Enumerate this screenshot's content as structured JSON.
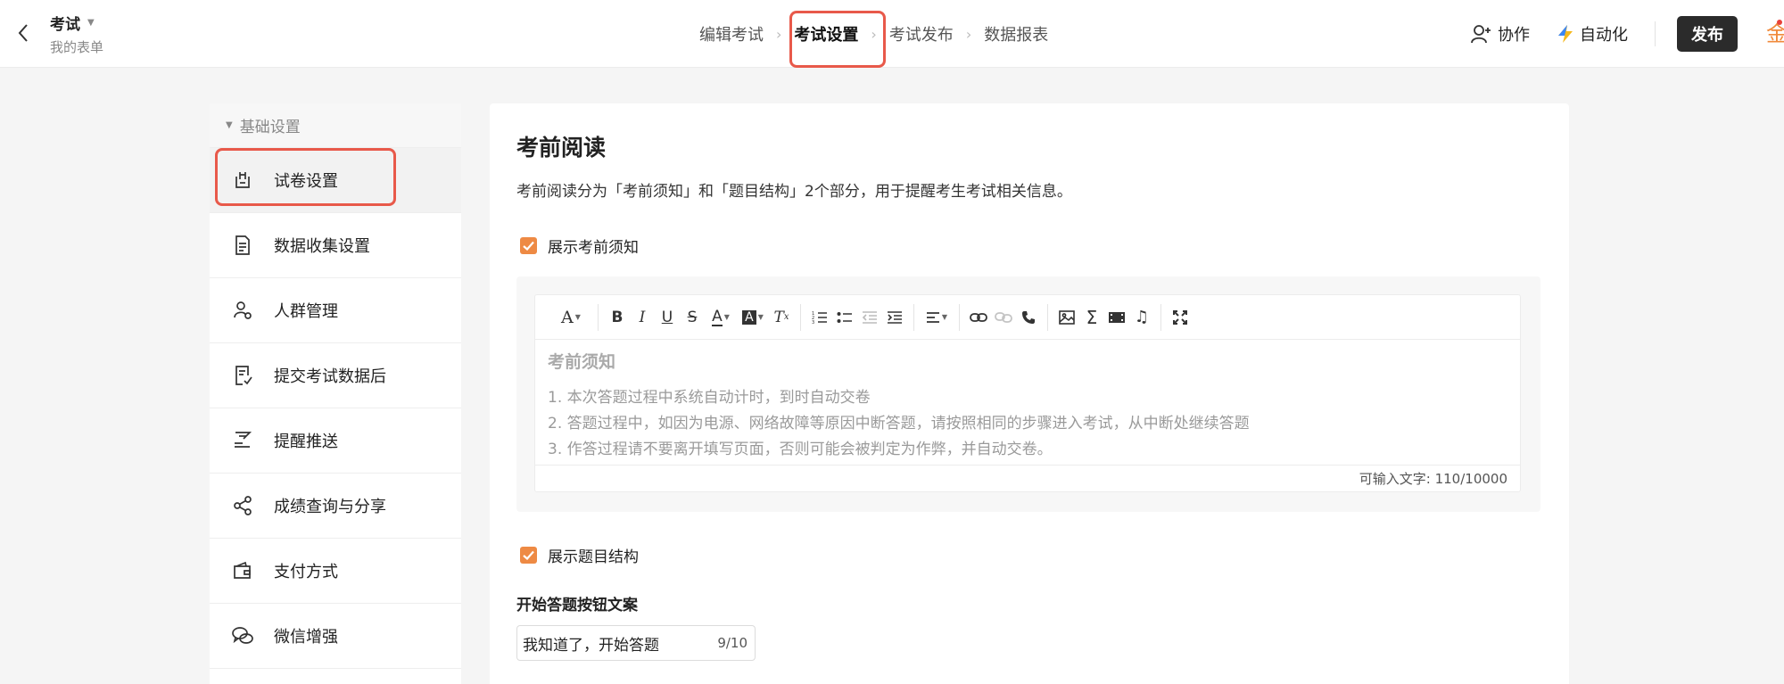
{
  "header": {
    "form_title": "考试",
    "form_subtitle": "我的表单",
    "steps": [
      "编辑考试",
      "考试设置",
      "考试发布",
      "数据报表"
    ],
    "collab": "协作",
    "automation": "自动化",
    "publish": "发布",
    "vip": "金",
    "accent_color": "#e8594a"
  },
  "sidebar": {
    "group": "基础设置",
    "items": [
      {
        "label": "试卷设置",
        "icon": "exam-paper-icon"
      },
      {
        "label": "数据收集设置",
        "icon": "document-icon"
      },
      {
        "label": "人群管理",
        "icon": "user-group-icon"
      },
      {
        "label": "提交考试数据后",
        "icon": "submit-check-icon"
      },
      {
        "label": "提醒推送",
        "icon": "notification-icon"
      },
      {
        "label": "成绩查询与分享",
        "icon": "share-icon"
      },
      {
        "label": "支付方式",
        "icon": "wallet-icon"
      },
      {
        "label": "微信增强",
        "icon": "wechat-icon"
      }
    ]
  },
  "main": {
    "title": "考前阅读",
    "description": "考前阅读分为「考前须知」和「题目结构」2个部分，用于提醒考生考试相关信息。",
    "show_notice": "展示考前须知",
    "editor": {
      "heading": "考前须知",
      "lines": [
        "1. 本次答题过程中系统自动计时，到时自动交卷",
        "2. 答题过程中，如因为电源、网络故障等原因中断答题，请按照相同的步骤进入考试，从中断处继续答题",
        "3. 作答过程请不要离开填写页面，否则可能会被判定为作弊，并自动交卷。"
      ],
      "counter": "可输入文字: 110/10000"
    },
    "show_structure": "展示题目结构",
    "start_button_label": "开始答题按钮文案",
    "start_button_value": "我知道了，开始答题",
    "start_button_count": "9/10",
    "checkbox_color": "#ee8a44"
  }
}
